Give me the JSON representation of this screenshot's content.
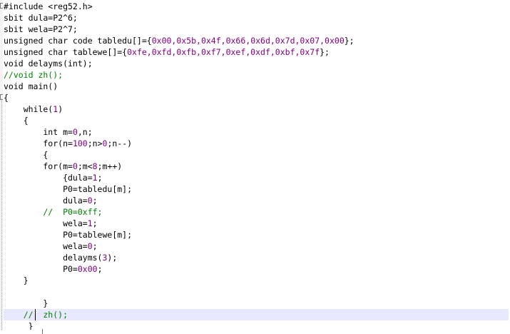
{
  "editor": {
    "lines": [
      {
        "segments": [
          {
            "t": "#include <reg52.h>",
            "c": "pre"
          }
        ]
      },
      {
        "segments": [
          {
            "t": "sbit dula=P2^6;",
            "c": "plain"
          }
        ]
      },
      {
        "segments": [
          {
            "t": "sbit wela=P2^7;",
            "c": "plain"
          }
        ]
      },
      {
        "segments": [
          {
            "t": "unsigned char code tabledu[]={",
            "c": "plain"
          },
          {
            "t": "0x00,0x5b,0x4f,0x66,0x6d,0x7d,0x07,0x00",
            "c": "num"
          },
          {
            "t": "};",
            "c": "plain"
          }
        ]
      },
      {
        "segments": [
          {
            "t": "unsigned char tablewe[]={",
            "c": "plain"
          },
          {
            "t": "0xfe,0xfd,0xfb,0xf7,0xef,0xdf,0xbf,0x7f",
            "c": "num"
          },
          {
            "t": "};",
            "c": "plain"
          }
        ]
      },
      {
        "segments": [
          {
            "t": "void delayms(int);",
            "c": "plain"
          }
        ]
      },
      {
        "segments": [
          {
            "t": "//void zh();",
            "c": "cmt"
          }
        ]
      },
      {
        "segments": [
          {
            "t": "void main()",
            "c": "plain"
          }
        ]
      },
      {
        "segments": [
          {
            "t": "{",
            "c": "plain"
          }
        ]
      },
      {
        "segments": [
          {
            "t": "    while(",
            "c": "plain"
          },
          {
            "t": "1",
            "c": "num"
          },
          {
            "t": ")",
            "c": "plain"
          }
        ]
      },
      {
        "segments": [
          {
            "t": "    {",
            "c": "plain"
          }
        ]
      },
      {
        "segments": [
          {
            "t": "        int m=",
            "c": "plain"
          },
          {
            "t": "0",
            "c": "num"
          },
          {
            "t": ",n;",
            "c": "plain"
          }
        ]
      },
      {
        "segments": [
          {
            "t": "        for(n=",
            "c": "plain"
          },
          {
            "t": "100",
            "c": "num"
          },
          {
            "t": ";n>",
            "c": "plain"
          },
          {
            "t": "0",
            "c": "num"
          },
          {
            "t": ";n--)",
            "c": "plain"
          }
        ]
      },
      {
        "segments": [
          {
            "t": "        {",
            "c": "plain"
          }
        ]
      },
      {
        "segments": [
          {
            "t": "        for(m=",
            "c": "plain"
          },
          {
            "t": "0",
            "c": "num"
          },
          {
            "t": ";m<",
            "c": "plain"
          },
          {
            "t": "8",
            "c": "num"
          },
          {
            "t": ";m++)",
            "c": "plain"
          }
        ]
      },
      {
        "segments": [
          {
            "t": "            {dula=",
            "c": "plain"
          },
          {
            "t": "1",
            "c": "num"
          },
          {
            "t": ";",
            "c": "plain"
          }
        ]
      },
      {
        "segments": [
          {
            "t": "            P0=tabledu[m];",
            "c": "plain"
          }
        ]
      },
      {
        "segments": [
          {
            "t": "            dula=",
            "c": "plain"
          },
          {
            "t": "0",
            "c": "num"
          },
          {
            "t": ";",
            "c": "plain"
          }
        ]
      },
      {
        "segments": [
          {
            "t": "        //  P0=0xff;",
            "c": "cmt"
          }
        ]
      },
      {
        "segments": [
          {
            "t": "            wela=",
            "c": "plain"
          },
          {
            "t": "1",
            "c": "num"
          },
          {
            "t": ";",
            "c": "plain"
          }
        ]
      },
      {
        "segments": [
          {
            "t": "            P0=tablewe[m];",
            "c": "plain"
          }
        ]
      },
      {
        "segments": [
          {
            "t": "            wela=",
            "c": "plain"
          },
          {
            "t": "0",
            "c": "num"
          },
          {
            "t": ";",
            "c": "plain"
          }
        ]
      },
      {
        "segments": [
          {
            "t": "            delayms(",
            "c": "plain"
          },
          {
            "t": "3",
            "c": "num"
          },
          {
            "t": ");",
            "c": "plain"
          }
        ]
      },
      {
        "segments": [
          {
            "t": "            P0=",
            "c": "plain"
          },
          {
            "t": "0x00",
            "c": "num"
          },
          {
            "t": ";",
            "c": "plain"
          }
        ]
      },
      {
        "segments": [
          {
            "t": "    }",
            "c": "plain"
          }
        ]
      },
      {
        "segments": [
          {
            "t": "",
            "c": "plain"
          }
        ]
      },
      {
        "segments": [
          {
            "t": "        }",
            "c": "plain"
          }
        ]
      },
      {
        "segments": [
          {
            "t": "    //  zh();",
            "c": "cmt"
          }
        ],
        "current": true
      },
      {
        "segments": [
          {
            "t": "     }",
            "c": "plain"
          }
        ]
      }
    ],
    "colors": {
      "comment": "#008000",
      "number": "#800080",
      "current_line": "#e8e8ff",
      "text": "#000000"
    }
  }
}
